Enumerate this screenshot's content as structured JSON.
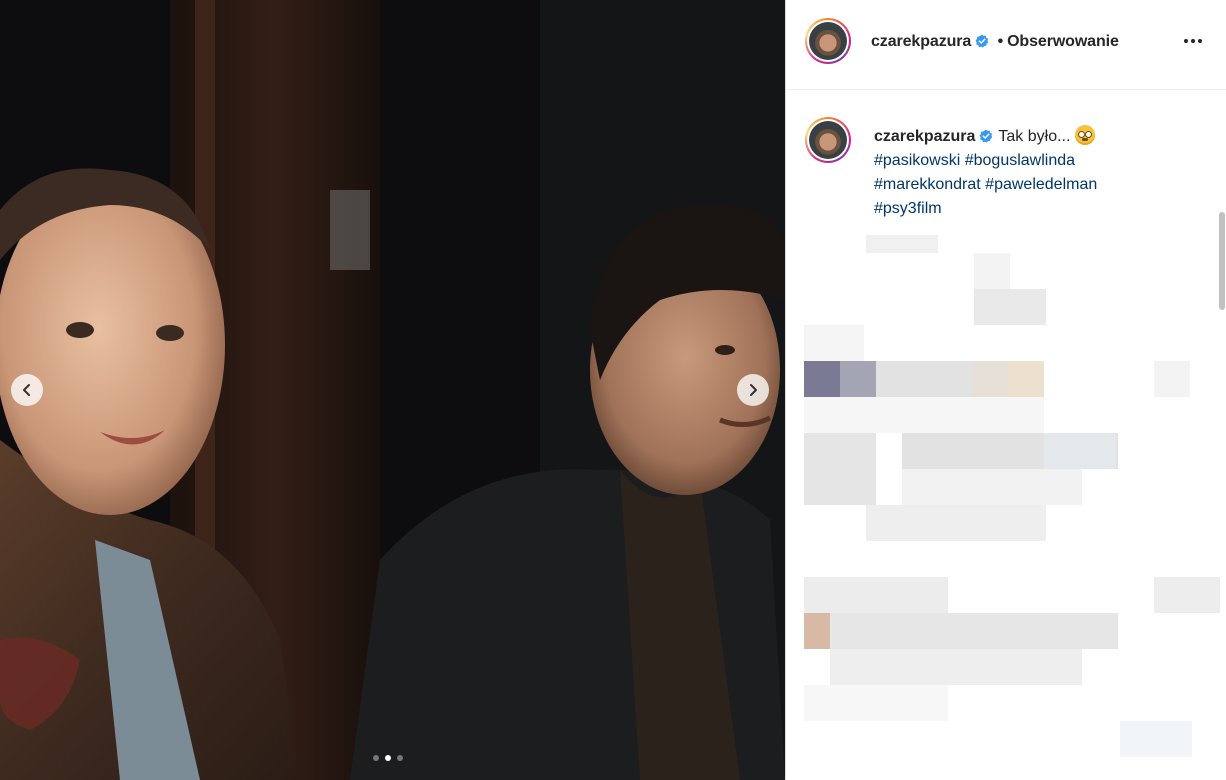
{
  "post": {
    "username": "czarekpazura",
    "follow_state": "Obserwowanie",
    "separator": "•",
    "caption_text": "Tak było...",
    "hashtags": [
      "#pasikowski",
      "#boguslawlinda",
      "#marekkondrat",
      "#paweledelman",
      "#psy3film"
    ],
    "media_count": 3,
    "active_media_index": 1
  },
  "icons": {
    "verified": "verified-badge-icon",
    "more": "more-options-icon",
    "prev": "chevron-left-icon",
    "next": "chevron-right-icon",
    "emoji": "flushed-face-emoji"
  },
  "colors": {
    "hashtag": "#00376b",
    "verified": "#3897f0",
    "text": "#262626"
  }
}
